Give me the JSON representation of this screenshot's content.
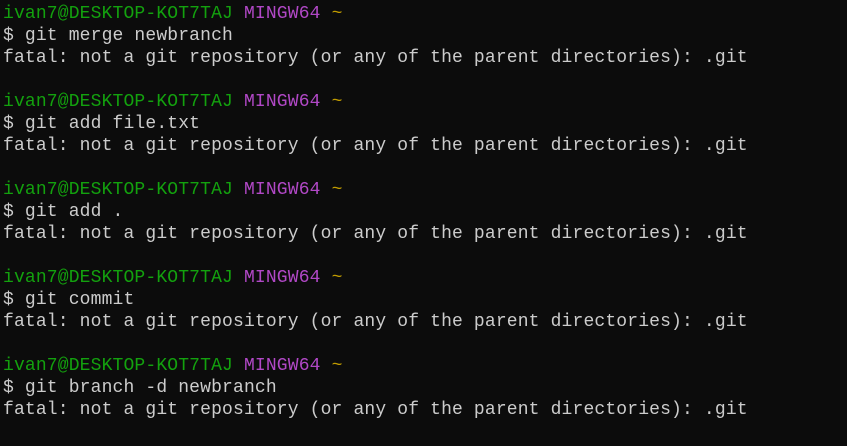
{
  "prompt": {
    "user_host": "ivan7@DESKTOP-KOT7TAJ",
    "system": "MINGW64",
    "path": "~",
    "symbol": "$"
  },
  "entries": [
    {
      "command": "git merge newbranch",
      "output": "fatal: not a git repository (or any of the parent directories): .git"
    },
    {
      "command": "git add file.txt",
      "output": "fatal: not a git repository (or any of the parent directories): .git"
    },
    {
      "command": "git add .",
      "output": "fatal: not a git repository (or any of the parent directories): .git"
    },
    {
      "command": "git commit",
      "output": "fatal: not a git repository (or any of the parent directories): .git"
    },
    {
      "command": "git branch -d newbranch",
      "output": "fatal: not a git repository (or any of the parent directories): .git"
    }
  ],
  "colors": {
    "background": "#0c0c0c",
    "text": "#cccccc",
    "user": "#13a10e",
    "system": "#b148c6",
    "path": "#c19c00"
  }
}
